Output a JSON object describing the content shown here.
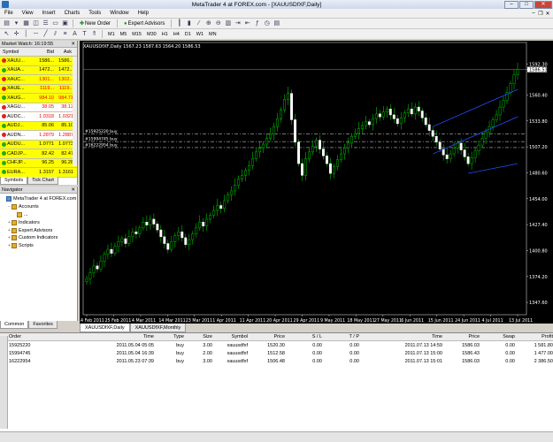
{
  "window": {
    "title": "MetaTrader 4 at FOREX.com - [XAUUSDfXF,Daily]"
  },
  "menu": [
    "File",
    "View",
    "Insert",
    "Charts",
    "Tools",
    "Window",
    "Help"
  ],
  "toolbar": {
    "new_order": "New Order",
    "expert_advisors": "Expert Advisors",
    "timeframes": [
      "M1",
      "M5",
      "M15",
      "M30",
      "H1",
      "H4",
      "D1",
      "W1",
      "MN"
    ]
  },
  "market_watch": {
    "title": "Market Watch: 16:19:55",
    "columns": [
      "Symbol",
      "Bid",
      "Ask"
    ],
    "rows": [
      {
        "symbol": "XAUU...",
        "bid": "1586...",
        "ask": "1586...",
        "dot": "r",
        "hl": true,
        "red": false
      },
      {
        "symbol": "XAUA...",
        "bid": "1472...",
        "ask": "1472...",
        "dot": "g",
        "hl": true,
        "red": false
      },
      {
        "symbol": "XAUC...",
        "bid": "1301...",
        "ask": "1302...",
        "dot": "r",
        "hl": true,
        "red": true
      },
      {
        "symbol": "XAUE...",
        "bid": "1119...",
        "ask": "1119...",
        "dot": "r",
        "hl": true,
        "red": true
      },
      {
        "symbol": "XAUG...",
        "bid": "984.10",
        "ask": "984.71",
        "dot": "g",
        "hl": true,
        "red": true
      },
      {
        "symbol": "XAGU...",
        "bid": "38.05",
        "ask": "38.12",
        "dot": "r",
        "hl": false,
        "red": true
      },
      {
        "symbol": "AUDC...",
        "bid": "1.0318",
        "ask": "1.0321",
        "dot": "r",
        "hl": false,
        "red": true
      },
      {
        "symbol": "AUDJ...",
        "bid": "85.06",
        "ask": "85.10",
        "dot": "g",
        "hl": true,
        "red": false
      },
      {
        "symbol": "AUDN...",
        "bid": "1.2879",
        "ask": "1.2887",
        "dot": "r",
        "hl": false,
        "red": true
      },
      {
        "symbol": "AUDU...",
        "bid": "1.0771",
        "ask": "1.0773",
        "dot": "g",
        "hl": true,
        "red": false
      },
      {
        "symbol": "CADJP...",
        "bid": "82.42",
        "ask": "82.47",
        "dot": "g",
        "hl": true,
        "red": false
      },
      {
        "symbol": "CHFJP...",
        "bid": "96.25",
        "ask": "96.28",
        "dot": "g",
        "hl": true,
        "red": false
      },
      {
        "symbol": "EURA...",
        "bid": "1.3157",
        "ask": "1.3161",
        "dot": "g",
        "hl": true,
        "red": false
      }
    ],
    "tabs": [
      "Symbols",
      "Tick Chart"
    ]
  },
  "navigator": {
    "title": "Navigator",
    "items": [
      {
        "label": "MetaTrader 4 at FOREX.com",
        "level": 0,
        "pm": "",
        "icon": "pc"
      },
      {
        "label": "Accounts",
        "level": 1,
        "pm": "−",
        "icon": "folder"
      },
      {
        "label": "...",
        "level": 2,
        "pm": "",
        "icon": "folder"
      },
      {
        "label": "Indicators",
        "level": 1,
        "pm": "+",
        "icon": "folder"
      },
      {
        "label": "Expert Advisors",
        "level": 1,
        "pm": "+",
        "icon": "folder"
      },
      {
        "label": "Custom Indicators",
        "level": 1,
        "pm": "+",
        "icon": "folder"
      },
      {
        "label": "Scripts",
        "level": 1,
        "pm": "+",
        "icon": "folder"
      }
    ],
    "tabs": [
      "Common",
      "Favorites"
    ]
  },
  "chart": {
    "info": "XAUUSDfXF,Daily  1567.23 1587.63 1564.20 1586.53",
    "price_ticks": [
      "1592.30",
      "1586.53",
      "1560.40",
      "1533.80",
      "1507.20",
      "1480.60",
      "1454.00",
      "1427.40",
      "1400.80",
      "1374.20",
      "1347.60"
    ],
    "current_price": "1586.53",
    "date_ticks": [
      "14 Feb 2011",
      "25 Feb 2011",
      "4 Mar 2011",
      "14 Mar 2011",
      "23 Mar 2011",
      "1 Apr 2011",
      "11 Apr 2011",
      "20 Apr 2011",
      "29 Apr 2011",
      "9 May 2011",
      "18 May 2011",
      "27 May 2011",
      "6 Jun 2011",
      "15 Jun 2011",
      "24 Jun 2011",
      "4 Jul 2011",
      "13 Jul 2011"
    ],
    "order_lines": [
      {
        "label": "#16222954 buy",
        "price": 1506.48
      },
      {
        "label": "#15994745 buy",
        "price": 1512.58
      },
      {
        "label": "#15925220 buy",
        "price": 1520.3
      }
    ],
    "tabs": [
      "XAUUSDfXF,Daily",
      "XAUUSDfXF,Monthly"
    ]
  },
  "chart_data": {
    "type": "candlestick",
    "ylim": [
      1335,
      1598
    ],
    "closes": [
      1372,
      1378,
      1385,
      1382,
      1390,
      1397,
      1402,
      1398,
      1405,
      1410,
      1413,
      1408,
      1415,
      1420,
      1418,
      1424,
      1430,
      1427,
      1433,
      1428,
      1422,
      1415,
      1408,
      1402,
      1410,
      1416,
      1420,
      1414,
      1407,
      1412,
      1418,
      1424,
      1430,
      1426,
      1433,
      1437,
      1442,
      1447,
      1444,
      1452,
      1458,
      1462,
      1468,
      1474,
      1478,
      1483,
      1488,
      1495,
      1502,
      1506,
      1510,
      1516,
      1520,
      1528,
      1536,
      1545,
      1556,
      1562,
      1535,
      1512,
      1490,
      1478,
      1495,
      1502,
      1508,
      1514,
      1505,
      1498,
      1490,
      1480,
      1487,
      1494,
      1500,
      1506,
      1511,
      1518,
      1521,
      1526,
      1529,
      1533,
      1530,
      1536,
      1541,
      1538,
      1543,
      1546,
      1540,
      1536,
      1531,
      1537,
      1542,
      1546,
      1541,
      1548,
      1544,
      1537,
      1530,
      1524,
      1518,
      1512,
      1505,
      1499,
      1495,
      1500,
      1506,
      1511,
      1504,
      1497,
      1490,
      1496,
      1503,
      1509,
      1516,
      1522,
      1528,
      1535,
      1540,
      1548,
      1555,
      1563,
      1572,
      1581,
      1586.53
    ]
  },
  "terminal": {
    "columns": [
      "Order",
      "Time",
      "Type",
      "Size",
      "Symbol",
      "Price",
      "S / L",
      "T / P",
      "Time",
      "Price",
      "Swap",
      "Profit"
    ],
    "rows": [
      [
        "15925220",
        "2011.05.04 05:05",
        "buy",
        "3.00",
        "xauusdfxf",
        "1520.30",
        "0.00",
        "0.00",
        "2011.07.13 14:59",
        "1586.03",
        "0.00",
        "1 581.80"
      ],
      [
        "15994745",
        "2011.05.04 16:39",
        "buy",
        "2.00",
        "xauusdfxf",
        "1512.58",
        "0.00",
        "0.00",
        "2011.07.13 15:00",
        "1586.43",
        "0.00",
        "1 477.00"
      ],
      [
        "16222954",
        "2011.05.23 07:39",
        "buy",
        "3.00",
        "xauusdfxf",
        "1506.48",
        "0.00",
        "0.00",
        "2011.07.13 15:01",
        "1586.03",
        "0.00",
        "2 386.50"
      ]
    ]
  }
}
